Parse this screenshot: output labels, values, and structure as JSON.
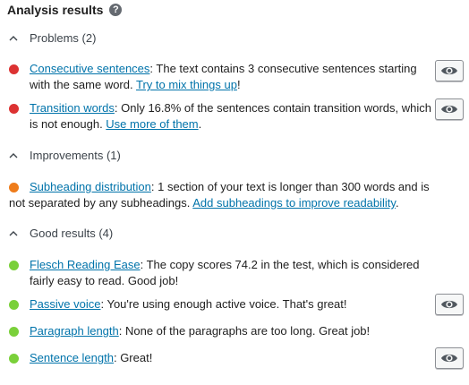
{
  "header": {
    "title": "Analysis results",
    "help_glyph": "?"
  },
  "sections": {
    "problems": {
      "label": "Problems (2)"
    },
    "improvements": {
      "label": "Improvements (1)"
    },
    "good": {
      "label": "Good results (4)"
    }
  },
  "items": {
    "consecutive": {
      "link": "Consecutive sentences",
      "text": ": The text contains 3 consecutive sentences starting with the same word. ",
      "cta": "Try to mix things up",
      "tail": "!",
      "status": "red"
    },
    "transition": {
      "link": "Transition words",
      "text": ": Only 16.8% of the sentences contain transition words, which is not enough. ",
      "cta": "Use more of them",
      "tail": ".",
      "status": "red"
    },
    "subheading": {
      "link": "Subheading distribution",
      "text": ": 1 section of your text is longer than 300 words and is not separated by any subheadings. ",
      "cta": "Add subheadings to improve readability",
      "tail": ".",
      "status": "orange"
    },
    "flesch": {
      "link": "Flesch Reading Ease",
      "text": ": The copy scores 74.2 in the test, which is considered fairly easy to read. Good job!",
      "status": "green"
    },
    "passive": {
      "link": "Passive voice",
      "text": ": You're using enough active voice. That's great!",
      "status": "green"
    },
    "paragraph": {
      "link": "Paragraph length",
      "text": ": None of the paragraphs are too long. Great job!",
      "status": "green"
    },
    "sentence": {
      "link": "Sentence length",
      "text": ": Great!",
      "status": "green"
    }
  },
  "colors": {
    "red": "#dc3232",
    "orange": "#ee7c1b",
    "green": "#7ad03a",
    "link": "#0073aa"
  },
  "icons": {
    "eye": "eye-icon",
    "chevron": "chevron-up-icon",
    "help": "help-icon"
  }
}
